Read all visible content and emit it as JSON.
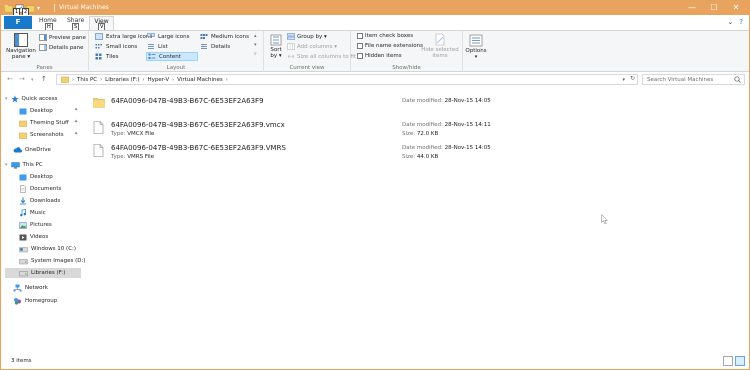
{
  "window": {
    "title": "Virtual Machines",
    "accent_color": "#e8a45e",
    "quick_access_keytips": [
      "1",
      "2"
    ],
    "controls": {
      "minimize": "—",
      "maximize": "☐",
      "close": "✕"
    }
  },
  "tabs": {
    "file": {
      "label": "F"
    },
    "items": [
      {
        "label": "Home",
        "keytip": "H"
      },
      {
        "label": "Share",
        "keytip": "S"
      },
      {
        "label": "View",
        "keytip": "V",
        "active": true
      }
    ]
  },
  "ribbon": {
    "panes": {
      "label": "Panes",
      "navigation_pane": "Navigation\npane ▾",
      "preview_pane": "Preview pane",
      "details_pane": "Details pane"
    },
    "layout": {
      "label": "Layout",
      "items": [
        {
          "label": "Extra large icons",
          "icon": "extra-large-icons-icon"
        },
        {
          "label": "Large icons",
          "icon": "large-icons-icon"
        },
        {
          "label": "Medium icons",
          "icon": "medium-icons-icon"
        },
        {
          "label": "Small icons",
          "icon": "small-icons-icon"
        },
        {
          "label": "List",
          "icon": "list-icon"
        },
        {
          "label": "Details",
          "icon": "details-icon"
        },
        {
          "label": "Tiles",
          "icon": "tiles-icon"
        },
        {
          "label": "Content",
          "icon": "content-icon",
          "selected": true
        }
      ]
    },
    "current_view": {
      "label": "Current view",
      "sort_by": "Sort\nby ▾",
      "group_by": "Group by ▾",
      "add_columns": "Add columns ▾",
      "size_all_columns": "Size all columns to fit"
    },
    "show_hide": {
      "label": "Show/hide",
      "item_check_boxes": "Item check boxes",
      "file_name_extensions": "File name extensions",
      "hidden_items": "Hidden items",
      "hide_selected_items": "Hide selected\nitems"
    },
    "options": {
      "label": "Options"
    }
  },
  "address": {
    "path": [
      "This PC",
      "Libraries (F:)",
      "Hyper-V",
      "Virtual Machines"
    ],
    "search_placeholder": "Search Virtual Machines"
  },
  "nav": {
    "items": [
      {
        "label": "Quick access",
        "icon": "star-icon",
        "level": 0,
        "pinned": false
      },
      {
        "label": "Desktop",
        "icon": "desktop-icon",
        "level": 1,
        "pinned": true
      },
      {
        "label": "Theming Stuff",
        "icon": "folder-icon",
        "level": 1,
        "pinned": true
      },
      {
        "label": "Screenshots",
        "icon": "folder-icon",
        "level": 1,
        "pinned": true
      },
      {
        "label": "OneDrive",
        "icon": "cloud-icon",
        "level": 0,
        "pinned": false
      },
      {
        "label": "This PC",
        "icon": "computer-icon",
        "level": 0,
        "pinned": false
      },
      {
        "label": "Desktop",
        "icon": "desktop-icon",
        "level": 1,
        "pinned": false
      },
      {
        "label": "Documents",
        "icon": "documents-icon",
        "level": 1,
        "pinned": false
      },
      {
        "label": "Downloads",
        "icon": "downloads-icon",
        "level": 1,
        "pinned": false
      },
      {
        "label": "Music",
        "icon": "music-icon",
        "level": 1,
        "pinned": false
      },
      {
        "label": "Pictures",
        "icon": "pictures-icon",
        "level": 1,
        "pinned": false
      },
      {
        "label": "Videos",
        "icon": "videos-icon",
        "level": 1,
        "pinned": false
      },
      {
        "label": "Windows 10 (C:)",
        "icon": "drive-icon",
        "level": 1,
        "pinned": false
      },
      {
        "label": "System Images (D:)",
        "icon": "drive-icon",
        "level": 1,
        "pinned": false
      },
      {
        "label": "Libraries (F:)",
        "icon": "drive-icon",
        "level": 1,
        "pinned": false,
        "selected": true
      },
      {
        "label": "Network",
        "icon": "network-icon",
        "level": 0,
        "pinned": false
      },
      {
        "label": "Homegroup",
        "icon": "homegroup-icon",
        "level": 0,
        "pinned": false
      }
    ]
  },
  "files": [
    {
      "name": "64FA0096-047B-49B3-B67C-6E53EF2A63F9",
      "kind": "folder",
      "type_label": "",
      "type": "",
      "date_label": "Date modified:",
      "date": "28-Nov-15 14:05",
      "size_label": "",
      "size": ""
    },
    {
      "name": "64FA0096-047B-49B3-B67C-6E53EF2A63F9.vmcx",
      "kind": "file",
      "type_label": "Type:",
      "type": "VMCX File",
      "date_label": "Date modified:",
      "date": "28-Nov-15 14:11",
      "size_label": "Size:",
      "size": "72.0 KB"
    },
    {
      "name": "64FA0096-047B-49B3-B67C-6E53EF2A63F9.VMRS",
      "kind": "file",
      "type_label": "Type:",
      "type": "VMRS File",
      "date_label": "Date modified:",
      "date": "28-Nov-15 14:05",
      "size_label": "Size:",
      "size": "44.0 KB"
    }
  ],
  "status": {
    "item_count": "3 items"
  }
}
